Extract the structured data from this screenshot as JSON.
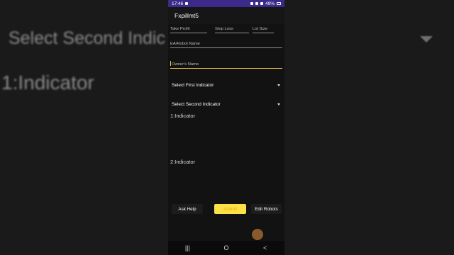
{
  "background": {
    "select_text": "Select Second Indic",
    "indicator_text": "1:Indicator"
  },
  "status_bar": {
    "time": "17:46",
    "battery": "49%"
  },
  "app": {
    "title": "Fxpillmt5"
  },
  "form": {
    "take_profit_placeholder": "Take Profit",
    "stop_loss_placeholder": "Stop Loss",
    "lot_size_placeholder": "Lot Size",
    "robot_name_placeholder": "EA/Robot Name",
    "owner_name_placeholder": "Owner's Name",
    "first_indicator": "Select First Indicator",
    "second_indicator": "Select Second Indicator",
    "indicator_1": "1:Indicator",
    "indicator_2": "2:Indicator"
  },
  "buttons": {
    "ask_help": "Ask Help",
    "submit": "Submit",
    "edit_robots": "Edit Robots"
  },
  "nav": {
    "recents": "|||",
    "home": "O",
    "back": "<"
  }
}
